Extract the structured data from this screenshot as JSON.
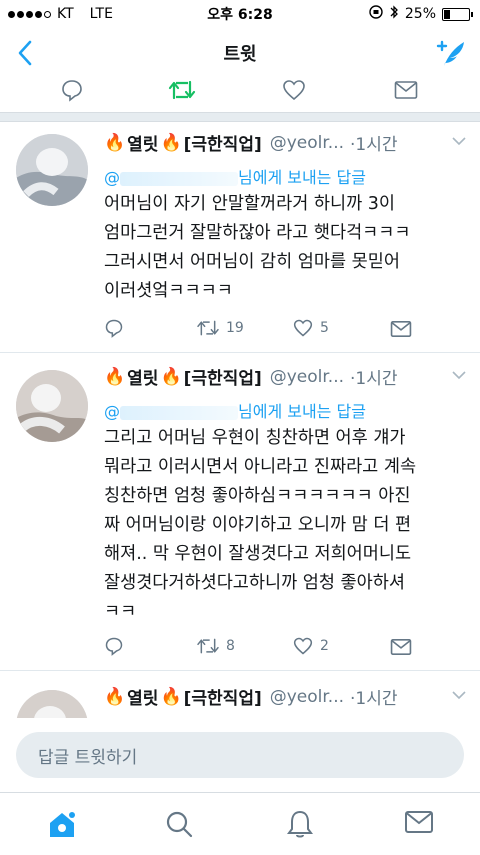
{
  "status": {
    "carrier": "KT",
    "network": "LTE",
    "time": "오후 6:28",
    "battery": "25%"
  },
  "nav": {
    "title": "트윗"
  },
  "tweets": [
    {
      "name": "열릿",
      "title_tag": "[극한직업]",
      "handle": "@yeolr...",
      "time": "·1시간",
      "reply_prefix": "@",
      "reply_suffix": "님에게 보내는 답글",
      "lines": [
        "어머님이 자기 안말할꺼라거 하니까 3이",
        "엄마그런거 잘말하잖아 라고 햇다걱ㅋㅋㅋ",
        "그러시면서 어머님이 감히 엄마를 못믿어",
        "이러셧엌ㅋㅋㅋㅋ"
      ],
      "retweets": "19",
      "likes": "5"
    },
    {
      "name": "열릿",
      "title_tag": "[극한직업]",
      "handle": "@yeolr...",
      "time": "·1시간",
      "reply_prefix": "@",
      "reply_suffix": "님에게 보내는 답글",
      "lines": [
        "그리고 어머님 우현이 칭찬하면 어후 걔가",
        "뭐라고 이러시면서 아니라고 진짜라고 계속",
        "칭찬하면 엄청 좋아하심ㅋㅋㅋㅋㅋㅋ 아진",
        "짜 어머님이랑 이야기하고 오니까 맘 더 편",
        "해져.. 막 우현이 잘생겻다고 저희어머니도",
        "잘생겻다거하셧다고하니까 엄청 좋아하셔",
        "ㅋㅋ"
      ],
      "retweets": "8",
      "likes": "2"
    },
    {
      "name": "열릿",
      "title_tag": "[극한직업]",
      "handle": "@yeolr...",
      "time": "·1시간"
    }
  ],
  "composer": {
    "placeholder": "답글 트윗하기"
  },
  "colors": {
    "accent": "#1da1f2",
    "retweet_green": "#17bf63",
    "gray": "#657786"
  },
  "icons": [
    "back-icon",
    "compose-icon",
    "reply-icon",
    "retweet-icon",
    "like-icon",
    "dm-icon",
    "home-icon",
    "search-icon",
    "notifications-icon",
    "messages-icon"
  ]
}
